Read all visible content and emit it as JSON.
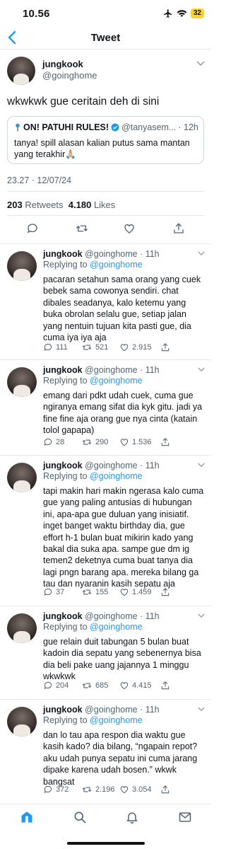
{
  "status_bar": {
    "time": "10.56",
    "battery": "32"
  },
  "nav": {
    "title": "Tweet"
  },
  "main_tweet": {
    "name": "jungkook",
    "handle": "@goinghome",
    "text": "wkwkwk gue ceritain deh di sini",
    "quote": {
      "name": "ON! PATUHI RULES!",
      "handle": "@tanyasem...",
      "time": "· 12h",
      "text": "tanya! spill alasan kalian putus sama mantan yang terakhir🙏🏼"
    },
    "timestamp": "23.27 · 12/07/24",
    "retweets_count": "203",
    "retweets_label": "Retweets",
    "likes_count": "4.180",
    "likes_label": "Likes"
  },
  "replies": [
    {
      "name": "jungkook",
      "handle": "@goinghome · 11h",
      "replying_label": "Replying to",
      "replying_to": "@goinghome",
      "text": "pacaran setahun sama orang yang cuek bebek sama cowonya sendiri. chat dibales seadanya, kalo ketemu yang buka obrolan selalu gue, setiap jalan yang nentuin tujuan kita pasti gue, dia cuma iya iya aja",
      "replies": "111",
      "retweets": "521",
      "likes": "2.915"
    },
    {
      "name": "jungkook",
      "handle": "@goinghome · 11h",
      "replying_label": "Replying to",
      "replying_to": "@goinghome",
      "text": "emang dari pdkt udah cuek, cuma gue ngiranya emang sifat dia kyk gitu. jadi ya fine fine aja orang gue nya cinta (katain tolol gapapa)",
      "replies": "28",
      "retweets": "290",
      "likes": "1.536"
    },
    {
      "name": "jungkook",
      "handle": "@goinghome · 11h",
      "replying_label": "Replying to",
      "replying_to": "@goinghome",
      "text": "tapi makin hari makin ngerasa kalo cuma gue yang paling antusias di hubungan ini, apa-apa gue duluan yang inisiatif. inget banget waktu birthday dia, gue effort h-1 bulan buat mikirin kado yang bakal dia suka apa. sampe gue dm ig temen2 deketnya cuma buat tanya dia lagi pngn barang apa. mereka bilang ga tau dan nyaranin kasih sepatu aja",
      "replies": "37",
      "retweets": "155",
      "likes": "1.459"
    },
    {
      "name": "jungkook",
      "handle": "@goinghome · 11h",
      "replying_label": "Replying to",
      "replying_to": "@goinghome",
      "text": "gue relain duit tabungan 5 bulan buat kadoin dia sepatu yang sebenernya bisa dia beli pake uang jajannya 1 minggu wkwkwk",
      "replies": "204",
      "retweets": "685",
      "likes": "4.415"
    },
    {
      "name": "jungkook",
      "handle": "@goinghome · 11h",
      "replying_label": "Replying to",
      "replying_to": "@goinghome",
      "text": "dan lo tau apa respon dia waktu gue kasih kado? dia bilang, “ngapain repot? aku udah punya sepatu ini cuma jarang dipake karena udah bosen.” wkwk bangsat",
      "replies": "372",
      "retweets": "2.196",
      "likes": "3.054"
    }
  ]
}
